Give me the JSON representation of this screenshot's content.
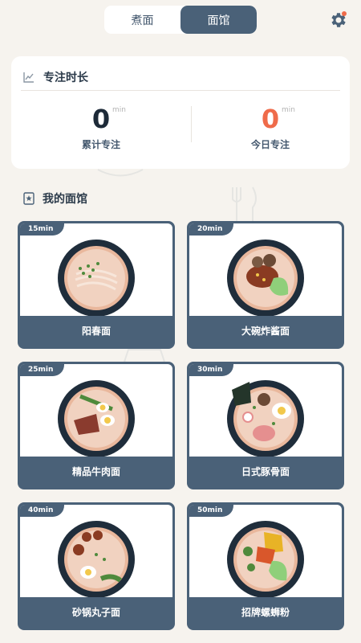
{
  "tabs": [
    {
      "label": "煮面",
      "active": false
    },
    {
      "label": "面馆",
      "active": true
    }
  ],
  "focus": {
    "title": "专注时长",
    "total": {
      "value": "0",
      "unit": "min",
      "label": "累计专注"
    },
    "today": {
      "value": "0",
      "unit": "min",
      "label": "今日专注"
    }
  },
  "section": {
    "title": "我的面馆"
  },
  "shops": [
    {
      "time": "15min",
      "name": "阳春面"
    },
    {
      "time": "20min",
      "name": "大碗炸酱面"
    },
    {
      "time": "25min",
      "name": "精品牛肉面"
    },
    {
      "time": "30min",
      "name": "日式豚骨面"
    },
    {
      "time": "40min",
      "name": "砂锅丸子面"
    },
    {
      "time": "50min",
      "name": "招牌螺蛳粉"
    }
  ],
  "colors": {
    "accent": "#4a6178",
    "highlight": "#ef6b4a",
    "background": "#f6f3ee"
  }
}
